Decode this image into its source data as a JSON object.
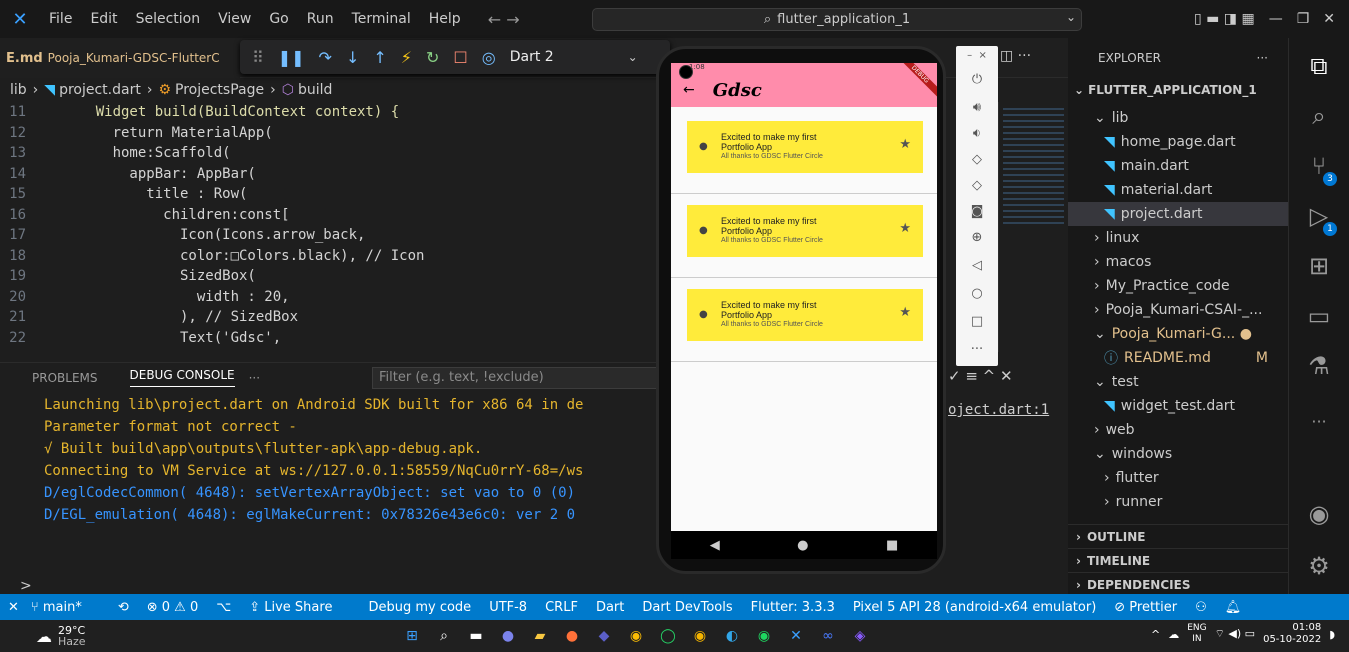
{
  "titlebar": {
    "menus": [
      "File",
      "Edit",
      "Selection",
      "View",
      "Go",
      "Run",
      "Terminal",
      "Help"
    ],
    "search": "flutter_application_1"
  },
  "tab": {
    "label": "E.md",
    "file": "Pooja_Kumari-GDSC-FlutterC"
  },
  "debug": {
    "config": "Dart 2"
  },
  "breadcrumb": {
    "folder": "lib",
    "file": "project.dart",
    "class": "ProjectsPage",
    "method": "build"
  },
  "code": [
    {
      "n": "11",
      "t": "    Widget build(BuildContext context) {"
    },
    {
      "n": "12",
      "t": "      return MaterialApp("
    },
    {
      "n": "13",
      "t": "      home:Scaffold("
    },
    {
      "n": "14",
      "t": "        appBar: AppBar("
    },
    {
      "n": "15",
      "t": "          title : Row("
    },
    {
      "n": "16",
      "t": "            children:const["
    },
    {
      "n": "17",
      "t": "              Icon(Icons.arrow_back,"
    },
    {
      "n": "18",
      "t": "              color:□Colors.black), // Icon"
    },
    {
      "n": "19",
      "t": "              SizedBox("
    },
    {
      "n": "20",
      "t": "                width : 20,"
    },
    {
      "n": "21",
      "t": "              ), // SizedBox"
    },
    {
      "n": "22",
      "t": "              Text('Gdsc',"
    }
  ],
  "panel": {
    "problems": "PROBLEMS",
    "debug_console": "DEBUG CONSOLE",
    "more": "···",
    "filter_placeholder": "Filter (e.g. text, !exclude)",
    "link": "oject.dart:1"
  },
  "console": [
    {
      "t": "Launching lib\\project.dart on Android SDK built for x86 64 in de",
      "c": "#e5b52d"
    },
    {
      "t": "Parameter format not correct -",
      "c": "#e5b52d"
    },
    {
      "t": "√  Built build\\app\\outputs\\flutter-apk\\app-debug.apk.",
      "c": "#e5b52d"
    },
    {
      "t": "Connecting to VM Service at ws://127.0.0.1:58559/NqCu0rrY-68=/ws",
      "c": "#e5b52d"
    },
    {
      "t": "D/eglCodecCommon( 4648): setVertexArrayObject: set vao to 0 (0)",
      "c": "#3794ff"
    },
    {
      "t": "D/EGL_emulation( 4648): eglMakeCurrent: 0x78326e43e6c0: ver 2 0",
      "c": "#3794ff"
    }
  ],
  "explorer": {
    "title": "EXPLORER",
    "project": "FLUTTER_APPLICATION_1",
    "items": [
      {
        "label": "lib",
        "indent": 1,
        "kind": "open"
      },
      {
        "label": "home_page.dart",
        "indent": 2,
        "kind": "dart"
      },
      {
        "label": "main.dart",
        "indent": 2,
        "kind": "dart"
      },
      {
        "label": "material.dart",
        "indent": 2,
        "kind": "dart"
      },
      {
        "label": "project.dart",
        "indent": 2,
        "kind": "dart",
        "selected": true
      },
      {
        "label": "linux",
        "indent": 1,
        "kind": "closed"
      },
      {
        "label": "macos",
        "indent": 1,
        "kind": "closed"
      },
      {
        "label": "My_Practice_code",
        "indent": 1,
        "kind": "closed"
      },
      {
        "label": "Pooja_Kumari-CSAI-_...",
        "indent": 1,
        "kind": "closed"
      },
      {
        "label": "Pooja_Kumari-G... ●",
        "indent": 1,
        "kind": "open",
        "color": "#e2c08d"
      },
      {
        "label": "README.md",
        "indent": 2,
        "kind": "info",
        "color": "#e2c08d",
        "badge": "M"
      },
      {
        "label": "test",
        "indent": 1,
        "kind": "open"
      },
      {
        "label": "widget_test.dart",
        "indent": 2,
        "kind": "dart"
      },
      {
        "label": "web",
        "indent": 1,
        "kind": "closed"
      },
      {
        "label": "windows",
        "indent": 1,
        "kind": "open"
      },
      {
        "label": "flutter",
        "indent": 2,
        "kind": "closed"
      },
      {
        "label": "runner",
        "indent": 2,
        "kind": "closed"
      }
    ],
    "sections": [
      "OUTLINE",
      "TIMELINE",
      "DEPENDENCIES"
    ]
  },
  "activity_badges": {
    "scm": "3",
    "debug": "1"
  },
  "phone": {
    "time": "1:08",
    "title": "Gdsc",
    "cards": [
      {
        "title": "Excited to make my first",
        "title2": "Portfolio App",
        "subtitle": "All thanks to GDSC Flutter Circle"
      },
      {
        "title": "Excited to make my first",
        "title2": "Portfolio App",
        "subtitle": "All thanks to GDSC Flutter Circle"
      },
      {
        "title": "Excited to make my first",
        "title2": "Portfolio App",
        "subtitle": "All thanks to GDSC Flutter Circle"
      }
    ],
    "banner": "DEBUG"
  },
  "statusbar": {
    "branch": "main*",
    "errors": "⊗ 0 ⚠ 0",
    "liveshare": "Live Share",
    "debug": "Debug my code",
    "encoding": "UTF-8",
    "eol": "CRLF",
    "lang": "Dart",
    "devtools": "Dart DevTools",
    "flutter": "Flutter: 3.3.3",
    "device": "Pixel 5 API 28 (android-x64 emulator)",
    "prettier": "⊘ Prettier"
  },
  "taskbar": {
    "temp": "29°C",
    "weather": "Haze",
    "lang": "ENG",
    "region": "IN",
    "time": "01:08",
    "date": "05-10-2022"
  },
  "colors": {
    "accent": "#007acc",
    "appbar": "#ff8cab",
    "card": "#ffeb3b"
  }
}
